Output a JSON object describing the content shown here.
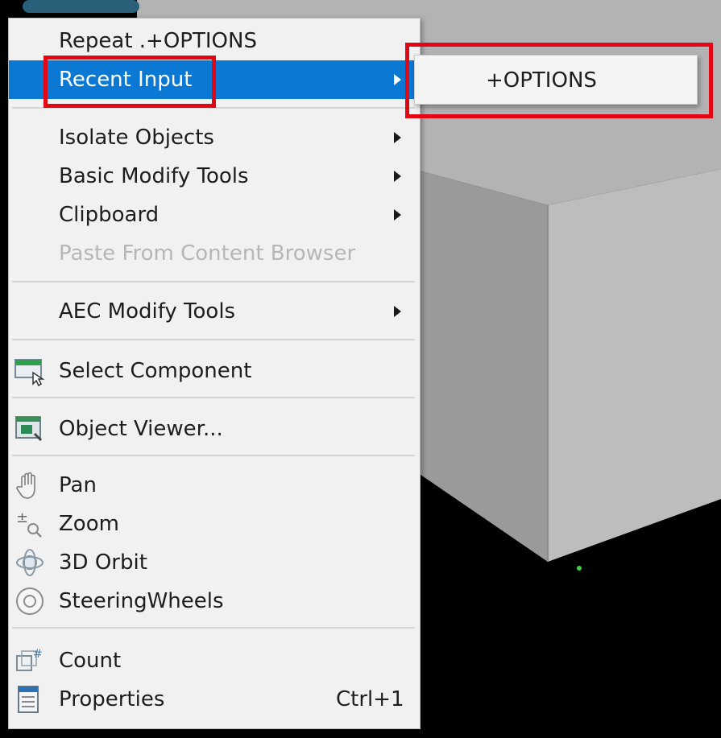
{
  "context_menu": {
    "items": {
      "repeat": {
        "label": "Repeat .+OPTIONS"
      },
      "recent_input": {
        "label": "Recent Input"
      },
      "isolate_objects": {
        "label": "Isolate Objects"
      },
      "basic_modify_tools": {
        "label": "Basic Modify Tools"
      },
      "clipboard": {
        "label": "Clipboard"
      },
      "paste_from_content_browser": {
        "label": "Paste From Content Browser"
      },
      "aec_modify_tools": {
        "label": "AEC Modify Tools"
      },
      "select_component": {
        "label": "Select Component"
      },
      "object_viewer": {
        "label": "Object Viewer..."
      },
      "pan": {
        "label": "Pan"
      },
      "zoom": {
        "label": "Zoom"
      },
      "orbit_3d": {
        "label": "3D Orbit"
      },
      "steering_wheels": {
        "label": "SteeringWheels"
      },
      "count": {
        "label": "Count"
      },
      "properties": {
        "label": "Properties",
        "shortcut": "Ctrl+1"
      }
    }
  },
  "submenu_recent_input": {
    "items": [
      {
        "label": "+OPTIONS"
      }
    ]
  },
  "colors": {
    "highlight": "#0b78d4",
    "annotation_box": "#e30613",
    "menu_background": "#f1f1f1"
  }
}
